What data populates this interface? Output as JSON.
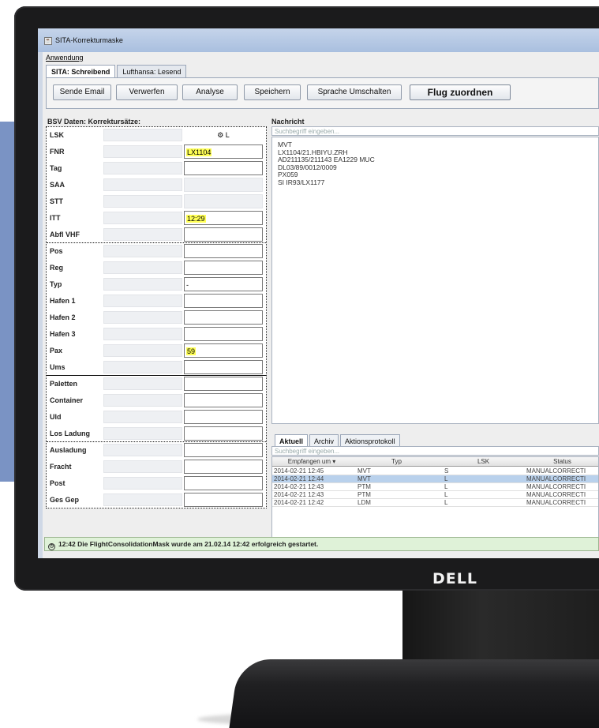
{
  "window": {
    "title": "SITA-Korrekturmaske"
  },
  "menubar": {
    "items": [
      "Anwendung"
    ]
  },
  "tabs": [
    {
      "label": "SITA: Schreibend"
    },
    {
      "label": "Lufthansa: Lesend"
    }
  ],
  "toolbar": {
    "send_email": "Sende Email",
    "discard": "Verwerfen",
    "analyse": "Analyse",
    "save": "Speichern",
    "switch_language": "Sprache Umschalten",
    "assign_flight": "Flug zuordnen"
  },
  "left_header": "BSV Daten: Korrektursätze:",
  "left_col_header": "L",
  "left_rows": [
    {
      "label": "LSK",
      "value": ""
    },
    {
      "label": "FNR",
      "value": "LX1104"
    },
    {
      "label": "Tag",
      "value": ""
    },
    {
      "label": "SAA",
      "value": ""
    },
    {
      "label": "STT",
      "value": ""
    },
    {
      "label": "ITT",
      "value": "12:29"
    },
    {
      "label": "Abfl VHF",
      "value": ""
    },
    {
      "label": "Pos",
      "value": ""
    },
    {
      "label": "Reg",
      "value": ""
    },
    {
      "label": "Typ",
      "value": "-"
    },
    {
      "label": "Hafen 1",
      "value": ""
    },
    {
      "label": "Hafen 2",
      "value": ""
    },
    {
      "label": "Hafen 3",
      "value": ""
    },
    {
      "label": "Pax",
      "value": "59"
    },
    {
      "label": "Ums",
      "value": ""
    },
    {
      "label": "Paletten",
      "value": ""
    },
    {
      "label": "Container",
      "value": ""
    },
    {
      "label": "Uld",
      "value": ""
    },
    {
      "label": "Los Ladung",
      "value": ""
    },
    {
      "label": "Ausladung",
      "value": ""
    },
    {
      "label": "Fracht",
      "value": ""
    },
    {
      "label": "Post",
      "value": ""
    },
    {
      "label": "Ges Gep",
      "value": ""
    }
  ],
  "message": {
    "header": "Nachricht",
    "search_placeholder": "Suchbegriff eingeben...",
    "lines": [
      "MVT",
      "LX1104/21.HBIYU.ZRH",
      "AD211135/211143 EA1229 MUC",
      "DL03/89/0012/0009",
      "PX059",
      "SI IR93/LX1177"
    ]
  },
  "bottom_tabs": [
    {
      "label": "Aktuell"
    },
    {
      "label": "Archiv"
    },
    {
      "label": "Aktionsprotokoll"
    }
  ],
  "table": {
    "search_placeholder": "Suchbegriff eingeben...",
    "columns": [
      "Empfangen um ▾",
      "Typ",
      "LSK",
      "Status"
    ],
    "rows": [
      {
        "time": "2014-02-21  12:45",
        "typ": "MVT",
        "lsk": "S",
        "status": "MANUALCORRECTI"
      },
      {
        "time": "2014-02-21  12:44",
        "typ": "MVT",
        "lsk": "L",
        "status": "MANUALCORRECTI"
      },
      {
        "time": "2014-02-21  12:43",
        "typ": "PTM",
        "lsk": "L",
        "status": "MANUALCORRECTI"
      },
      {
        "time": "2014-02-21  12:43",
        "typ": "PTM",
        "lsk": "L",
        "status": "MANUALCORRECTI"
      },
      {
        "time": "2014-02-21  12:42",
        "typ": "LDM",
        "lsk": "L",
        "status": "MANUALCORRECTI"
      }
    ],
    "selected_index": 1
  },
  "status_bar": {
    "text": "12:42  Die FlightConsolidationMask wurde am 21.02.14 12:42 erfolgreich gestartet."
  },
  "brand": "DELL",
  "colors": {
    "highlight": "#ffff55",
    "status_bg": "#dff2d8",
    "selection": "#b9d1ec"
  }
}
